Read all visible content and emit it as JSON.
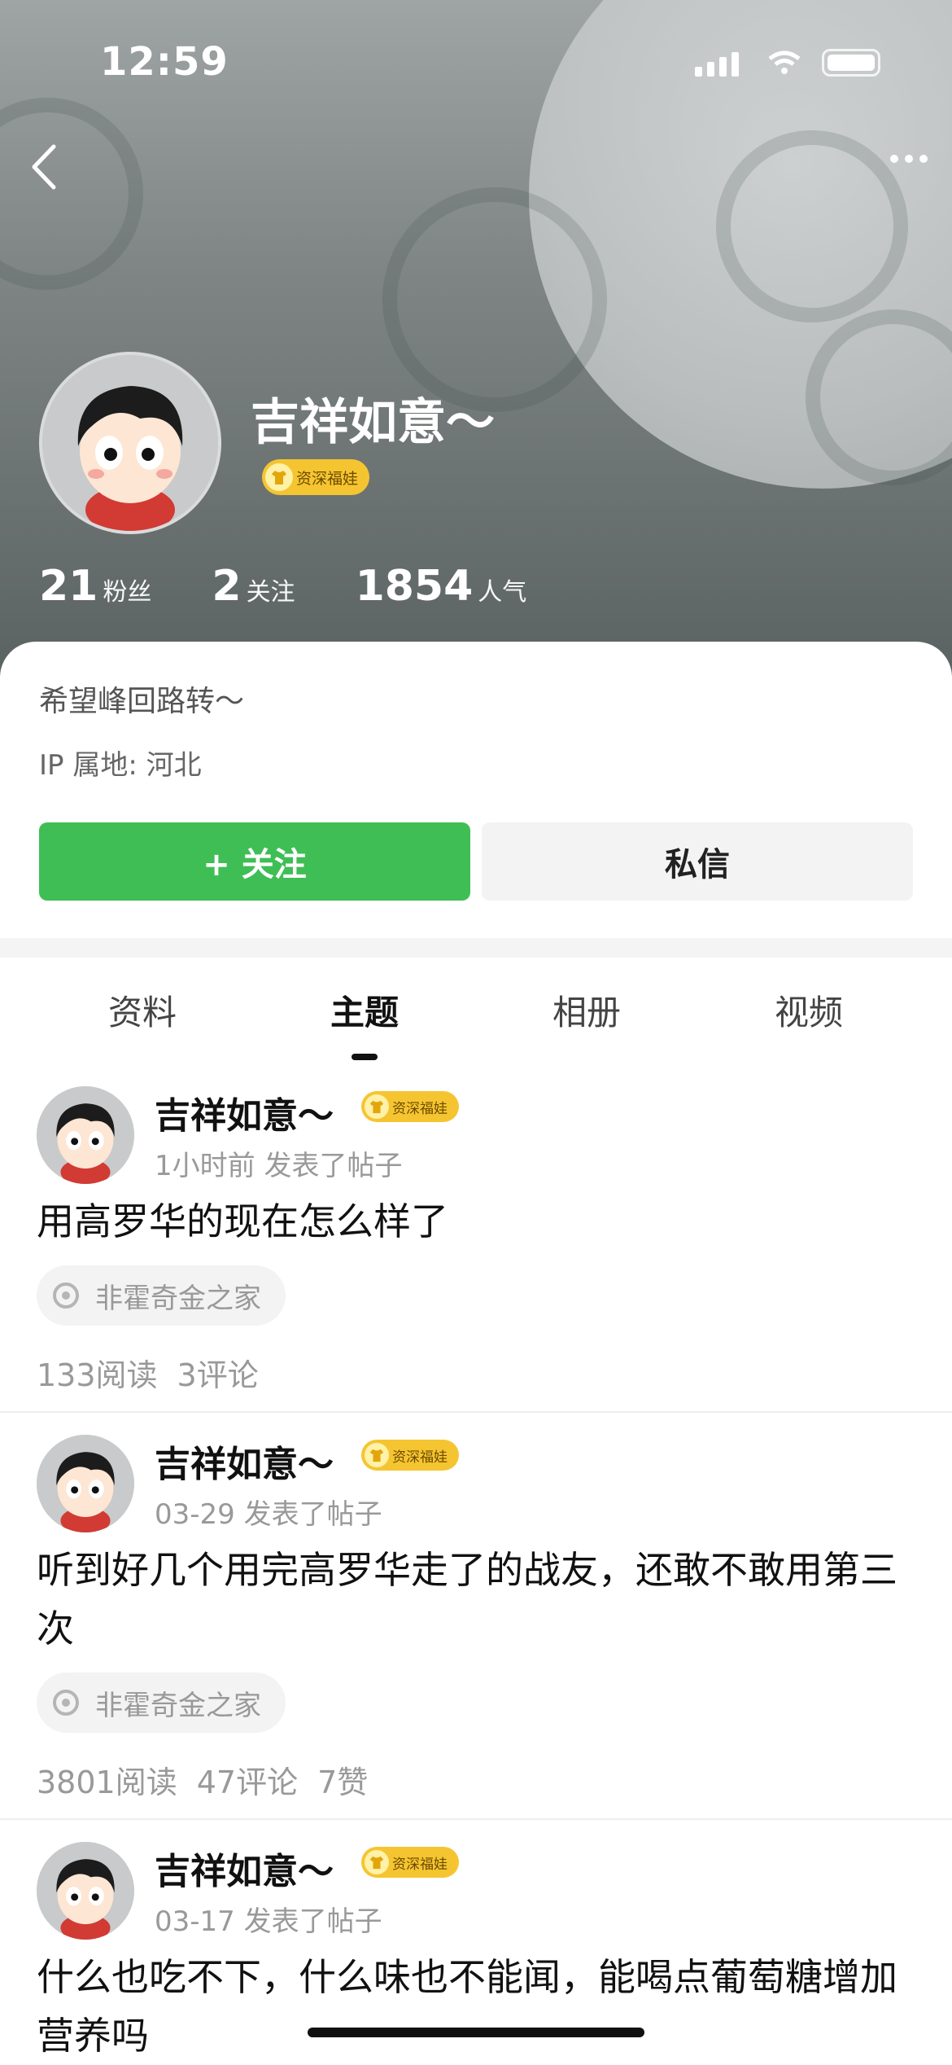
{
  "status_bar": {
    "time": "12:59"
  },
  "profile": {
    "username": "吉祥如意～",
    "badge": "资深福娃",
    "stats": [
      {
        "value": "21",
        "label": "粉丝"
      },
      {
        "value": "2",
        "label": "关注"
      },
      {
        "value": "1854",
        "label": "人气"
      }
    ],
    "signature": "希望峰回路转～",
    "ip_location": "IP 属地: 河北",
    "follow_button": "+ 关注",
    "message_button": "私信"
  },
  "tabs": [
    "资料",
    "主题",
    "相册",
    "视频"
  ],
  "active_tab": "主题",
  "posts": [
    {
      "author": "吉祥如意～",
      "badge": "资深福娃",
      "meta": "1小时前 发表了帖子",
      "title": "用高罗华的现在怎么样了",
      "forum": "非霍奇金之家",
      "reads": "133阅读",
      "comments": "3评论",
      "likes": ""
    },
    {
      "author": "吉祥如意～",
      "badge": "资深福娃",
      "meta": "03-29 发表了帖子",
      "title": "听到好几个用完高罗华走了的战友，还敢不敢用第三次",
      "forum": "非霍奇金之家",
      "reads": "3801阅读",
      "comments": "47评论",
      "likes": "7赞"
    },
    {
      "author": "吉祥如意～",
      "badge": "资深福娃",
      "meta": "03-17 发表了帖子",
      "title": "什么也吃不下，什么味也不能闻，能喝点葡萄糖增加营养吗"
    }
  ],
  "colors": {
    "accent_green": "#3fbe55",
    "badge_yellow": "#f5c531"
  }
}
